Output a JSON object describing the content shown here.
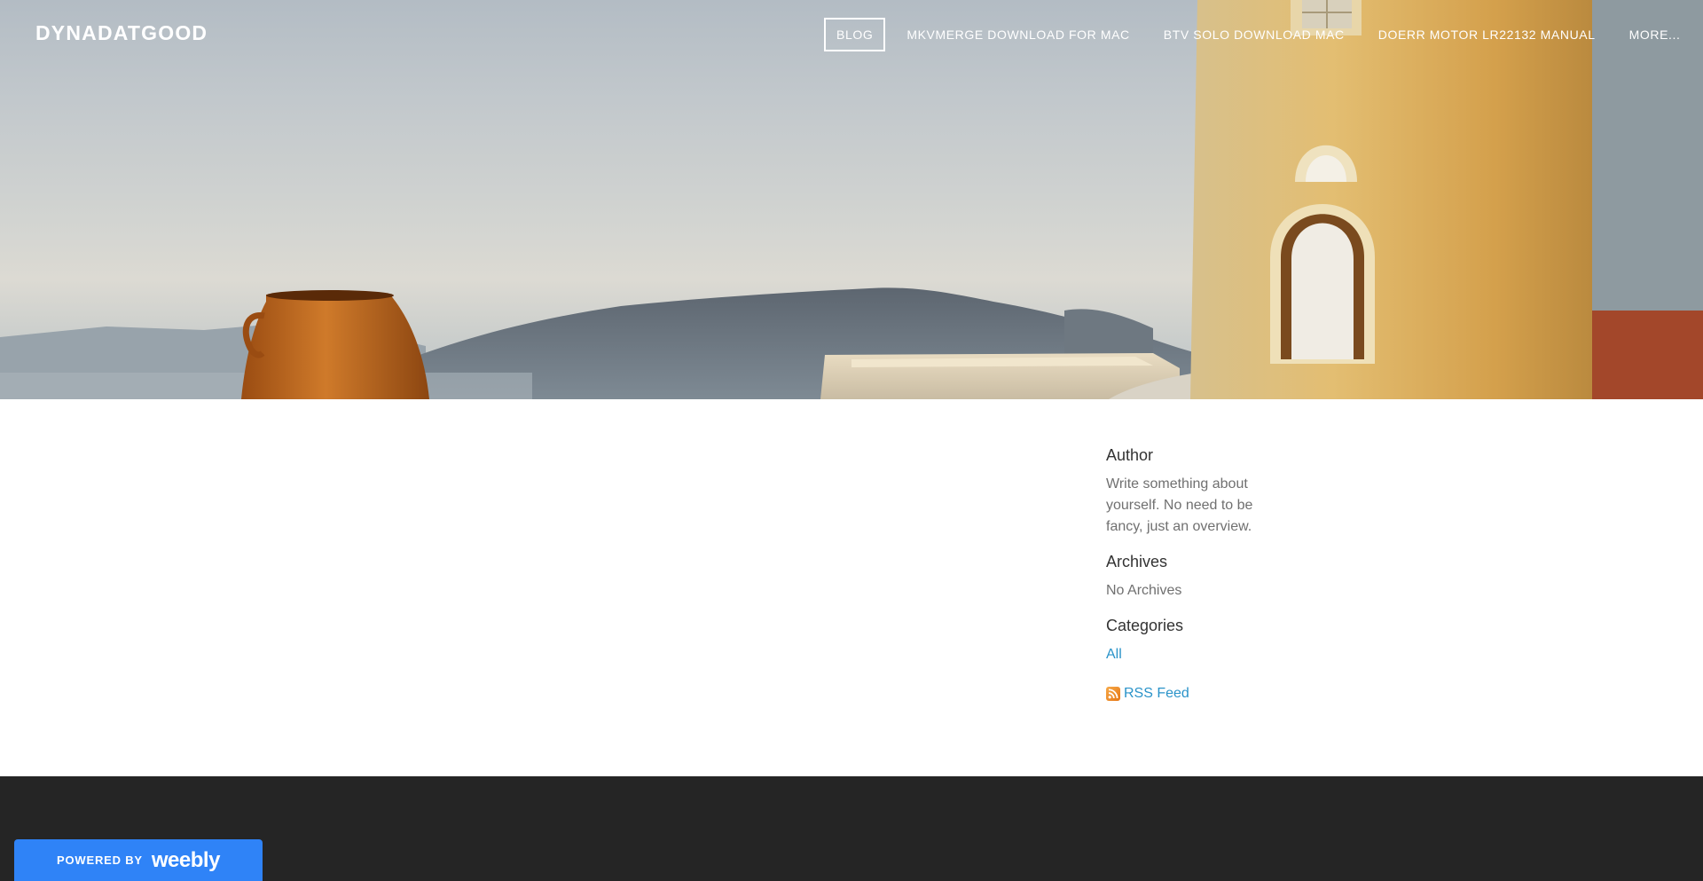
{
  "site": {
    "title": "DYNADATGOOD"
  },
  "nav": {
    "items": [
      {
        "label": "BLOG",
        "active": true
      },
      {
        "label": "MKVMERGE DOWNLOAD FOR MAC"
      },
      {
        "label": "BTV SOLO DOWNLOAD MAC"
      },
      {
        "label": "DOERR MOTOR LR22132 MANUAL"
      },
      {
        "label": "MORE..."
      }
    ]
  },
  "sidebar": {
    "author_heading": "Author",
    "author_text": "Write something about yourself. No need to be fancy, just an overview.",
    "archives_heading": "Archives",
    "archives_text": "No Archives",
    "categories_heading": "Categories",
    "categories_all": "All",
    "rss_label": "RSS Feed"
  },
  "footer": {
    "powered_by": "POWERED BY",
    "brand": "weebly"
  },
  "colors": {
    "link": "#2a93c9",
    "footer_bg": "#252525",
    "badge_bg": "#2f83f7"
  }
}
